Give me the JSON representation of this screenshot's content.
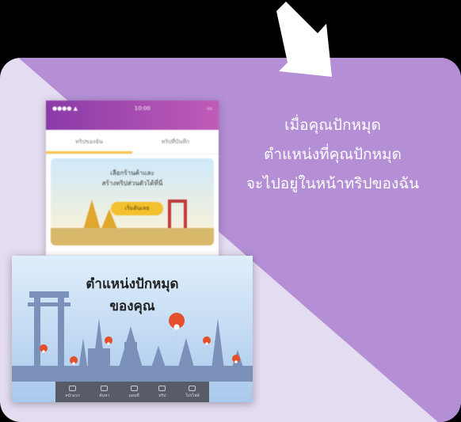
{
  "caption": {
    "line1": "เมื่อคุณปักหมุด",
    "line2": "ตำแหน่งที่คุณปักหมุด",
    "line3": "จะไปอยู่ในหน้าทริปของฉัน"
  },
  "phone": {
    "status_left": "●●●● ▲",
    "status_center": "10:00",
    "status_right": "▭",
    "tabs": [
      "ทริปของฉัน",
      "ทริปที่บันทึก"
    ],
    "banner_line1": "เลือกร้านค้าและ",
    "banner_line2": "สร้างทริปส่วนตัวได้ที่นี่",
    "banner_button": "เริ่มต้นเลย"
  },
  "map": {
    "title_line1": "ตำแหน่งปักหมุด",
    "title_line2": "ของคุณ",
    "nav_items": [
      "หน้าแรก",
      "ค้นหา",
      "แผนที่",
      "ทริป",
      "โปรไฟล์"
    ]
  },
  "colors": {
    "accent": "#b48fd6",
    "background": "#e4dcf0",
    "pin": "#e5502c",
    "skyline": "#7b91b9"
  }
}
